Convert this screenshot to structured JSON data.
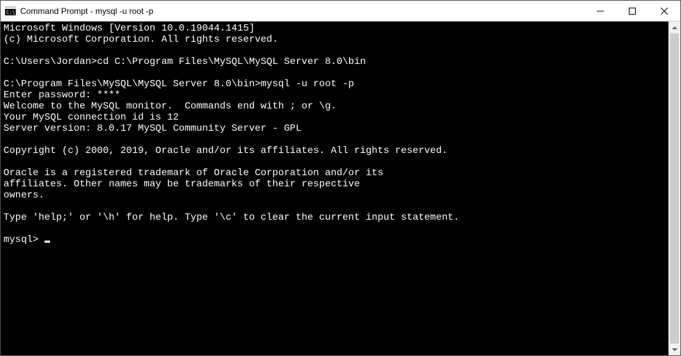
{
  "titlebar": {
    "title": "Command Prompt - mysql  -u root -p"
  },
  "terminal": {
    "lines": [
      "Microsoft Windows [Version 10.0.19044.1415]",
      "(c) Microsoft Corporation. All rights reserved.",
      "",
      "C:\\Users\\Jordan>cd C:\\Program Files\\MySQL\\MySQL Server 8.0\\bin",
      "",
      "C:\\Program Files\\MySQL\\MySQL Server 8.0\\bin>mysql -u root -p",
      "Enter password: ****",
      "Welcome to the MySQL monitor.  Commands end with ; or \\g.",
      "Your MySQL connection id is 12",
      "Server version: 8.0.17 MySQL Community Server - GPL",
      "",
      "Copyright (c) 2000, 2019, Oracle and/or its affiliates. All rights reserved.",
      "",
      "Oracle is a registered trademark of Oracle Corporation and/or its",
      "affiliates. Other names may be trademarks of their respective",
      "owners.",
      "",
      "Type 'help;' or '\\h' for help. Type '\\c' to clear the current input statement.",
      ""
    ],
    "prompt": "mysql> "
  }
}
